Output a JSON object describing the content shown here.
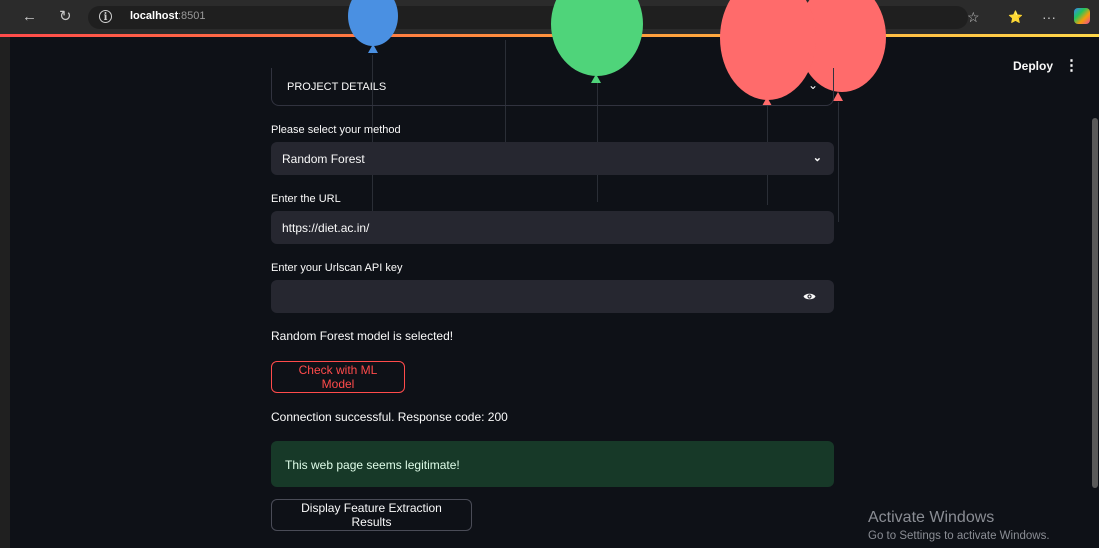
{
  "browser": {
    "url_host": "localhost",
    "url_port": ":8501",
    "back_glyph": "←",
    "reload_glyph": "↻",
    "info_glyph": "i",
    "favorite_glyph": "☆",
    "collections_glyph": "⭐",
    "more_glyph": "···"
  },
  "toolbar": {
    "deploy_label": "Deploy",
    "menu_glyph": "⋮"
  },
  "balloons": {
    "colors": [
      "#4a90e2",
      "#4fd47a",
      "#ff6b6b",
      "#ff6b6b"
    ]
  },
  "main": {
    "expander": {
      "label": "PROJECT DETAILS",
      "chevron": "⌄"
    },
    "method": {
      "label": "Please select your method",
      "value": "Random Forest",
      "chevron": "⌄"
    },
    "url_field": {
      "label": "Enter the URL",
      "value": "https://diet.ac.in/"
    },
    "api_key_field": {
      "label": "Enter your Urlscan API key",
      "value": "",
      "icon": "eye-icon"
    },
    "model_selected_text": "Random Forest model is selected!",
    "check_button_label": "Check with ML Model",
    "connection_text": "Connection successful. Response code: 200",
    "success_message": "This web page seems legitimate!",
    "feature_button_label": "Display Feature Extraction Results"
  },
  "watermark": {
    "title": "Activate Windows",
    "subtitle": "Go to Settings to activate Windows."
  },
  "colors": {
    "background": "#0e1117",
    "field_bg": "#262730",
    "accent_red": "#ff4b4b",
    "success_bg": "#173928"
  }
}
